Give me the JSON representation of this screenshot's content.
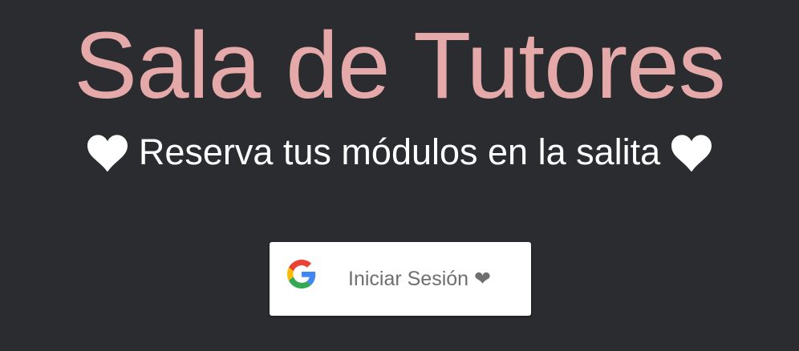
{
  "header": {
    "title": "Sala de Tutores",
    "subtitle": "Reserva tus módulos en la salita",
    "left_icon": "heart-icon",
    "right_icon": "heart-icon"
  },
  "login": {
    "icon": "google-icon",
    "label": "Iniciar Sesión ❤"
  },
  "colors": {
    "background": "#2b2c2f",
    "title": "#e6a9a9",
    "subtitle": "#ffffff",
    "button_background": "#ffffff",
    "button_text": "#6f6f6f"
  }
}
